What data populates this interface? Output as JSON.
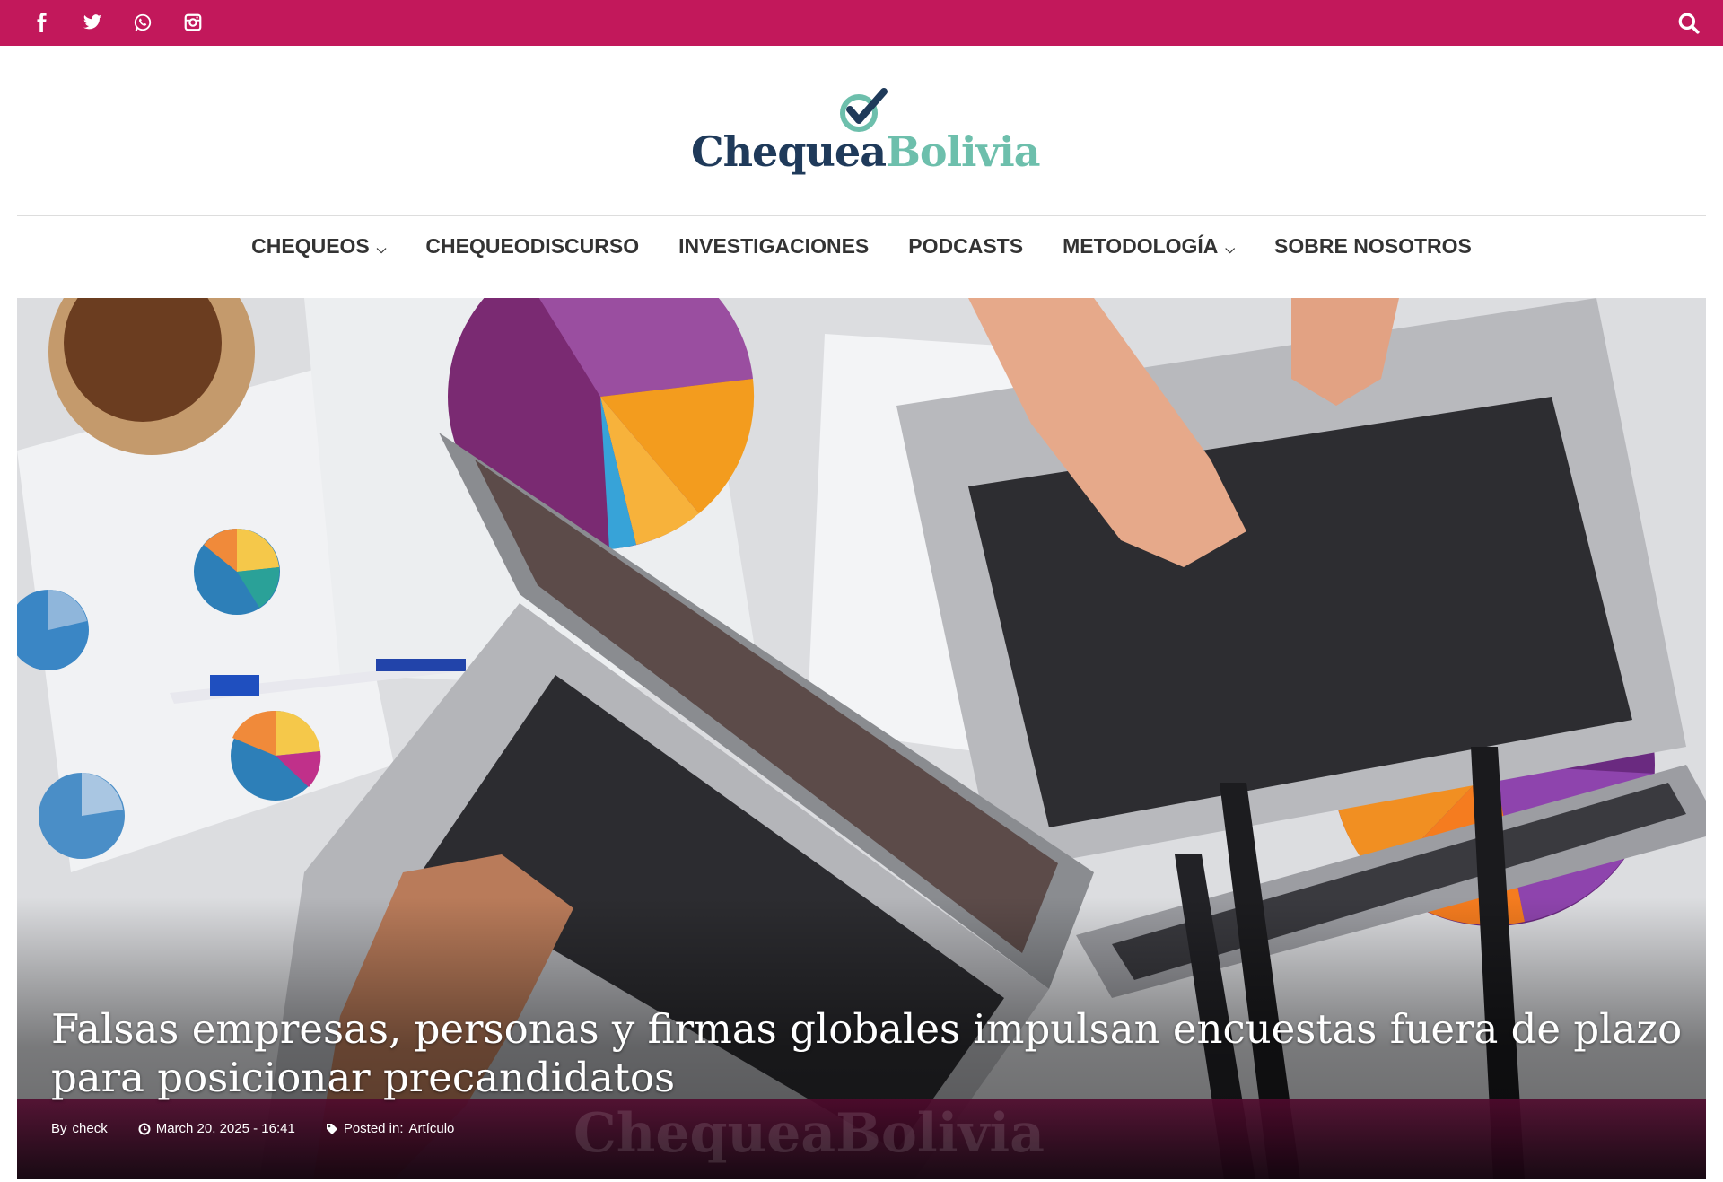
{
  "topbar": {
    "color": "#c2185b",
    "social": [
      {
        "icon": "facebook-icon"
      },
      {
        "icon": "twitter-icon"
      },
      {
        "icon": "whatsapp-icon"
      },
      {
        "icon": "instagram-icon"
      }
    ],
    "search_icon": "search-icon"
  },
  "logo": {
    "part1": "Chequea",
    "part2": "Bolivia",
    "colors": {
      "dark": "#1f3a5a",
      "teal": "#6dbfac"
    }
  },
  "nav": {
    "items": [
      {
        "label": "CHEQUEOS",
        "dropdown": true
      },
      {
        "label": "CHEQUEODISCURSO",
        "dropdown": false
      },
      {
        "label": "INVESTIGACIONES",
        "dropdown": false
      },
      {
        "label": "PODCASTS",
        "dropdown": false
      },
      {
        "label": "METODOLOGÍA",
        "dropdown": true
      },
      {
        "label": "SOBRE NOSOTROS",
        "dropdown": false
      }
    ]
  },
  "hero": {
    "title": "Falsas empresas, personas y firmas globales impulsan encuestas fuera de plazo para posicionar precandidatos",
    "watermark": "ChequeaBolivia",
    "author_prefix": "By",
    "author": "check",
    "date": "March 20, 2025 - 16:41",
    "category_prefix": "Posted in:",
    "category": "Artículo"
  }
}
